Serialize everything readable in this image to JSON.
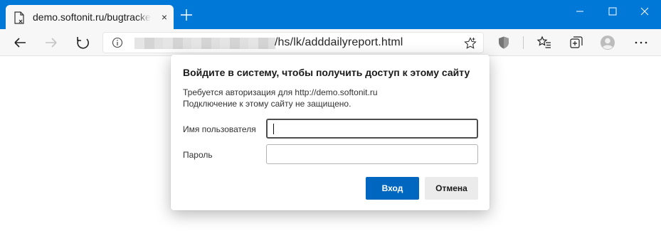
{
  "browser": {
    "tab": {
      "title": "demo.softonit.ru/bugtracker/hs/l",
      "close_glyph": "×"
    },
    "new_tab_icon": "plus-icon",
    "window_controls": [
      "minimize-icon",
      "maximize-icon",
      "close-icon"
    ],
    "address": {
      "url_visible": "/hs/lk/adddailyreport.html",
      "url_prefix_blurred": true
    },
    "toolbar_icons": [
      "back-arrow-icon",
      "forward-arrow-icon",
      "reload-icon",
      "info-icon",
      "star-icon",
      "shield-icon",
      "favorites-icon",
      "collections-icon",
      "profile-icon",
      "more-icon"
    ],
    "accent_color": "#0078d7"
  },
  "dialog": {
    "title": "Войдите в систему, чтобы получить доступ к этому сайту",
    "line1": "Требуется авторизация для http://demo.softonit.ru",
    "line2": "Подключение к этому сайту не защищено.",
    "username_label": "Имя пользователя",
    "username_value": "",
    "password_label": "Пароль",
    "password_value": "",
    "login_button": "Вход",
    "cancel_button": "Отмена",
    "primary_color": "#0067c0"
  }
}
